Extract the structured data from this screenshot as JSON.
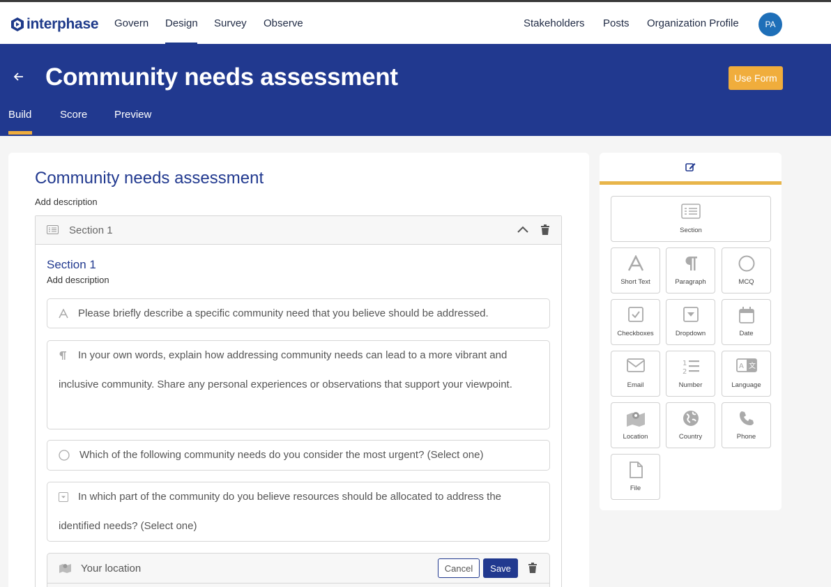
{
  "topbar": {
    "brand": "interphase",
    "nav_left": [
      "Govern",
      "Design",
      "Survey",
      "Observe"
    ],
    "nav_right": [
      "Stakeholders",
      "Posts",
      "Organization Profile"
    ],
    "avatar_initials": "PA"
  },
  "header": {
    "title": "Community needs assessment",
    "use_form_label": "Use Form",
    "tabs": [
      "Build",
      "Score",
      "Preview"
    ]
  },
  "form": {
    "title": "Community needs assessment",
    "description": "Add description",
    "section": {
      "header_label": "Section 1",
      "title": "Section 1",
      "description": "Add description"
    },
    "questions": [
      {
        "icon": "short-text-icon",
        "text": "Please briefly describe a specific community need that you believe should be addressed."
      },
      {
        "icon": "paragraph-icon",
        "text": "In your own words, explain how addressing community needs can lead to a more vibrant and inclusive community. Share any personal experiences or observations that support your viewpoint."
      },
      {
        "icon": "mcq-icon",
        "text": "Which of the following community needs do you consider the most urgent? (Select one)"
      },
      {
        "icon": "dropdown-icon",
        "text": "In which part of the community do you believe resources should be allocated to address the identified needs? (Select one)"
      }
    ],
    "editing": {
      "icon": "location-icon",
      "placeholder": "Your location",
      "cancel_label": "Cancel",
      "save_label": "Save"
    }
  },
  "toolbox": {
    "items": [
      "Section",
      "Short Text",
      "Paragraph",
      "MCQ",
      "Checkboxes",
      "Dropdown",
      "Date",
      "Email",
      "Number",
      "Language",
      "Location",
      "Country",
      "Phone",
      "File"
    ]
  },
  "colors": {
    "primary": "#21398f",
    "accent": "#f0ad3c",
    "avatar": "#1e6fb8"
  }
}
